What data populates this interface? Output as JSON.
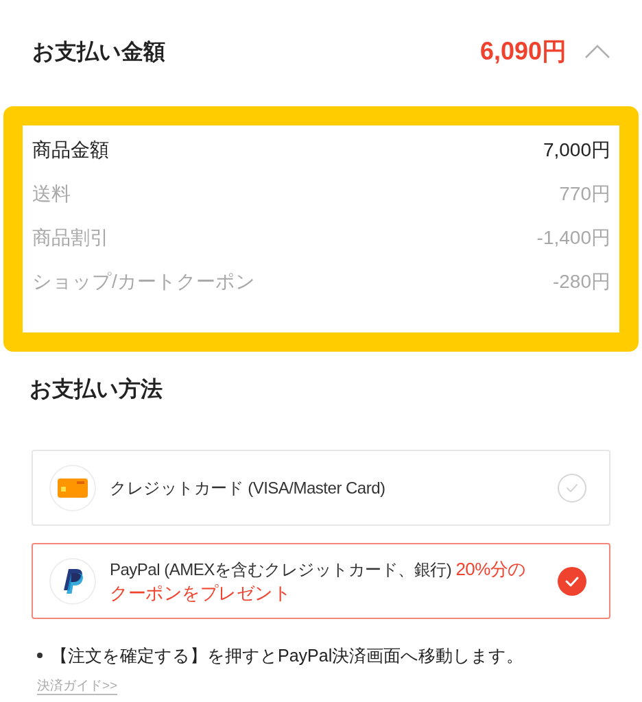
{
  "header": {
    "title": "お支払い金額",
    "total": "6,090円",
    "expanded": true
  },
  "breakdown": [
    {
      "kind": "subtotal",
      "label": "商品金額",
      "amount": "7,000円"
    },
    {
      "kind": "detail",
      "label": "送料",
      "amount": "770円"
    },
    {
      "kind": "detail",
      "label": "商品割引",
      "amount": "-1,400円"
    },
    {
      "kind": "detail",
      "label": "ショップ/カートクーポン",
      "amount": "-280円"
    }
  ],
  "payment": {
    "title": "お支払い方法",
    "options": [
      {
        "kind": "card",
        "label": "クレジットカード (VISA/Master Card)",
        "selected": false
      },
      {
        "kind": "paypal",
        "label": "PayPal (AMEXを含むクレジットカード、銀行) ",
        "promo": "20%分のクーポンをプレゼント",
        "selected": true
      }
    ]
  },
  "notice": {
    "text": "【注文を確定する】を押すとPayPal決済画面へ移動します。",
    "link": "決済ガイド>>"
  }
}
